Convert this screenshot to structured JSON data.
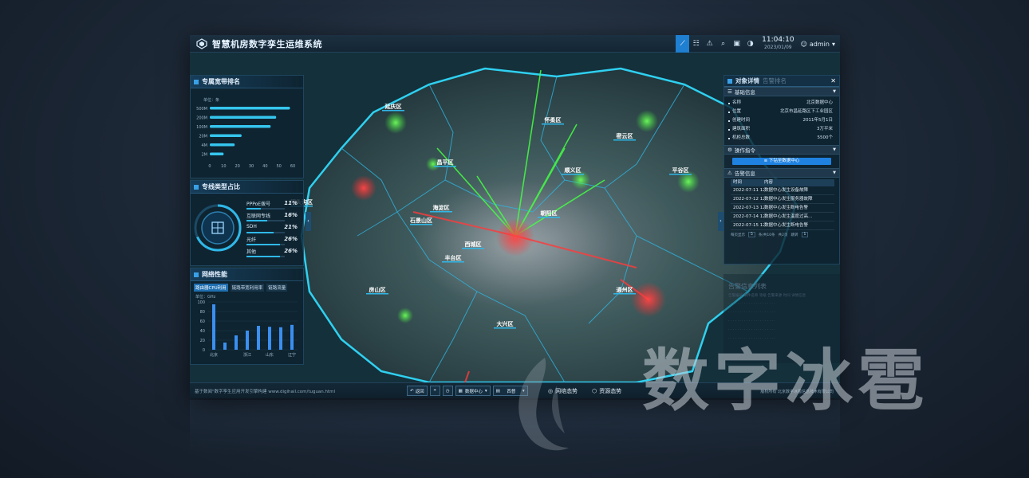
{
  "header": {
    "title": "智慧机房数字孪生运维系统",
    "time": "11:04:10",
    "date": "2023/01/09",
    "user": "admin",
    "toolbar_icons": [
      "chart-icon",
      "grid-icon",
      "warning-icon",
      "search-icon",
      "screen-icon",
      "contrast-icon"
    ]
  },
  "panel_bandwidth": {
    "title": "专属宽带排名",
    "unit": "单位：条"
  },
  "chart_data": [
    {
      "type": "bar",
      "orientation": "horizontal",
      "title": "专属宽带排名",
      "categories": [
        "500M",
        "200M",
        "100M",
        "20M",
        "4M",
        "2M"
      ],
      "values": [
        58,
        48,
        44,
        23,
        18,
        10
      ],
      "xlim": [
        0,
        60
      ],
      "xticks": [
        "0",
        "10",
        "20",
        "30",
        "40",
        "50",
        "60"
      ]
    },
    {
      "type": "bar",
      "title": "网络性能",
      "unit_label": "单位：GHz",
      "categories": [
        "北京",
        "",
        "",
        "浙江",
        "",
        "山东",
        "",
        "辽宁"
      ],
      "x_tick_labels": [
        "北京",
        "浙江",
        "山东",
        "辽宁"
      ],
      "values": [
        95,
        15,
        30,
        40,
        50,
        48,
        47,
        52
      ],
      "ylim": [
        0,
        100
      ],
      "yticks": [
        "0",
        "20",
        "40",
        "60",
        "80",
        "100"
      ]
    }
  ],
  "panel_share": {
    "title": "专线类型占比",
    "rows": [
      {
        "label": "PPPoE拨号",
        "pct": "11%",
        "frac": 0.11
      },
      {
        "label": "互联网专线",
        "pct": "16%",
        "frac": 0.16
      },
      {
        "label": "SDH",
        "pct": "21%",
        "frac": 0.21
      },
      {
        "label": "光纤",
        "pct": "26%",
        "frac": 0.26
      },
      {
        "label": "其他",
        "pct": "26%",
        "frac": 0.26
      }
    ]
  },
  "panel_network": {
    "title": "网络性能",
    "tabs": [
      "路由器CPU利用",
      "链路带宽利用率",
      "链路流量"
    ],
    "unit": "单位：GHz"
  },
  "panel_detail": {
    "title": "对象详情",
    "tab2": "告警排名",
    "section_basic": "基础信息",
    "info": [
      {
        "k": "名称",
        "v": "北京数据中心"
      },
      {
        "k": "位置",
        "v": "北京市昌延路区下工业园区"
      },
      {
        "k": "创建时间",
        "v": "2011年5月1日"
      },
      {
        "k": "建筑面积",
        "v": "3万平米"
      },
      {
        "k": "机柜总数",
        "v": "5500个"
      }
    ],
    "section_ops": "操作指令",
    "ops_button": "下钻至数据中心",
    "section_alarm": "告警信息",
    "alarm_headers": [
      "时间",
      "内容"
    ],
    "alarms": [
      {
        "time": "2022-07-11 12:0...",
        "content": "数据中心发生设备故障"
      },
      {
        "time": "2022-07-12 12:0...",
        "content": "数据中心发生服务器故障"
      },
      {
        "time": "2022-07-13 12:0...",
        "content": "数据中心发生断电告警"
      },
      {
        "time": "2022-07-14 12:0...",
        "content": "数据中心发生温度过高..."
      },
      {
        "time": "2022-07-15 12:0...",
        "content": "数据中心发生断电告警"
      }
    ],
    "pager": {
      "prefix": "每页显示",
      "size": "5",
      "info": "条/共10条",
      "pages": "共2页",
      "goto": "跳转",
      "page": "1"
    }
  },
  "panel_alarmlist": {
    "title": "告警信息列表",
    "headers": "告警编号  事件名称  等级  告警来源  时间  详情信息"
  },
  "map": {
    "districts": [
      "延庆区",
      "怀柔区",
      "密云区",
      "平谷区",
      "顺义区",
      "昌平区",
      "门头沟区",
      "海淀区",
      "朝阳区",
      "石景山区",
      "西城区",
      "丰台区",
      "通州区",
      "大兴区",
      "房山区"
    ]
  },
  "bottombar": {
    "tip": "基于数阅\"数字孪生应用开发引擎构建 www.digihail.com/tuguan.html",
    "back": "返回",
    "scene_select": "数据中心",
    "view_select": "西督",
    "mode1": "网络态势",
    "mode2": "资源态势",
    "copyright": "版权所有 北京数字冰雹信息技术有限公司"
  },
  "watermark": "数字冰雹",
  "colors": {
    "accent": "#1f82e0",
    "cyan": "#2fd0f0",
    "alarm_red": "#ff3b3b",
    "ok_green": "#46e046"
  }
}
